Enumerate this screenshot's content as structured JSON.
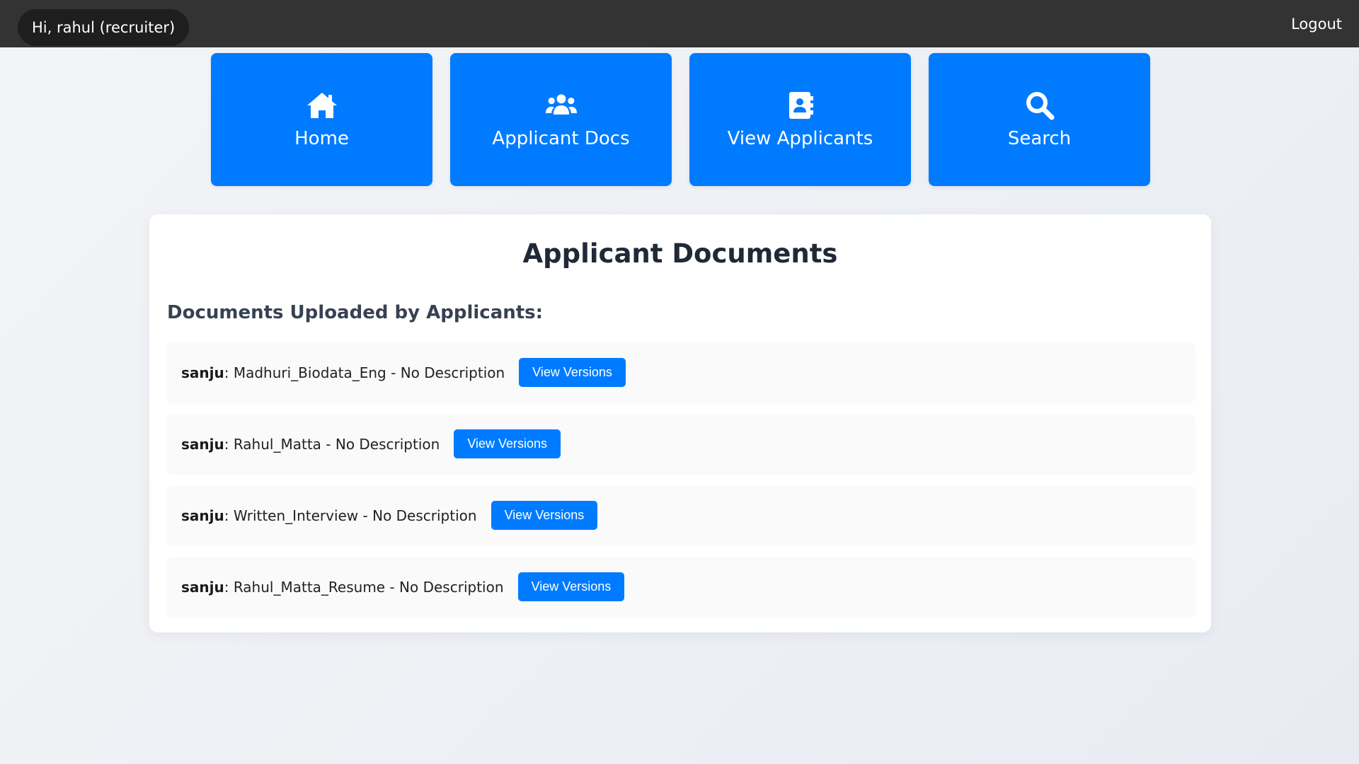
{
  "header": {
    "greeting": "Hi, rahul (recruiter)",
    "logout_label": "Logout"
  },
  "nav": [
    {
      "label": "Home",
      "icon": "home-icon"
    },
    {
      "label": "Applicant Docs",
      "icon": "users-icon"
    },
    {
      "label": "View Applicants",
      "icon": "address-book-icon"
    },
    {
      "label": "Search",
      "icon": "search-icon"
    }
  ],
  "main": {
    "title": "Applicant Documents",
    "subtitle": "Documents Uploaded by Applicants:",
    "documents": [
      {
        "user": "sanju",
        "sep": ": ",
        "name": "Madhuri_Biodata_Eng",
        "desc": " - No Description",
        "button": "View Versions"
      },
      {
        "user": "sanju",
        "sep": ": ",
        "name": "Rahul_Matta",
        "desc": " - No Description",
        "button": "View Versions"
      },
      {
        "user": "sanju",
        "sep": ": ",
        "name": "Written_Interview",
        "desc": " - No Description",
        "button": "View Versions"
      },
      {
        "user": "sanju",
        "sep": ": ",
        "name": "Rahul_Matta_Resume",
        "desc": " - No Description",
        "button": "View Versions"
      }
    ]
  },
  "colors": {
    "topbar": "#333333",
    "accent": "#007bff"
  }
}
